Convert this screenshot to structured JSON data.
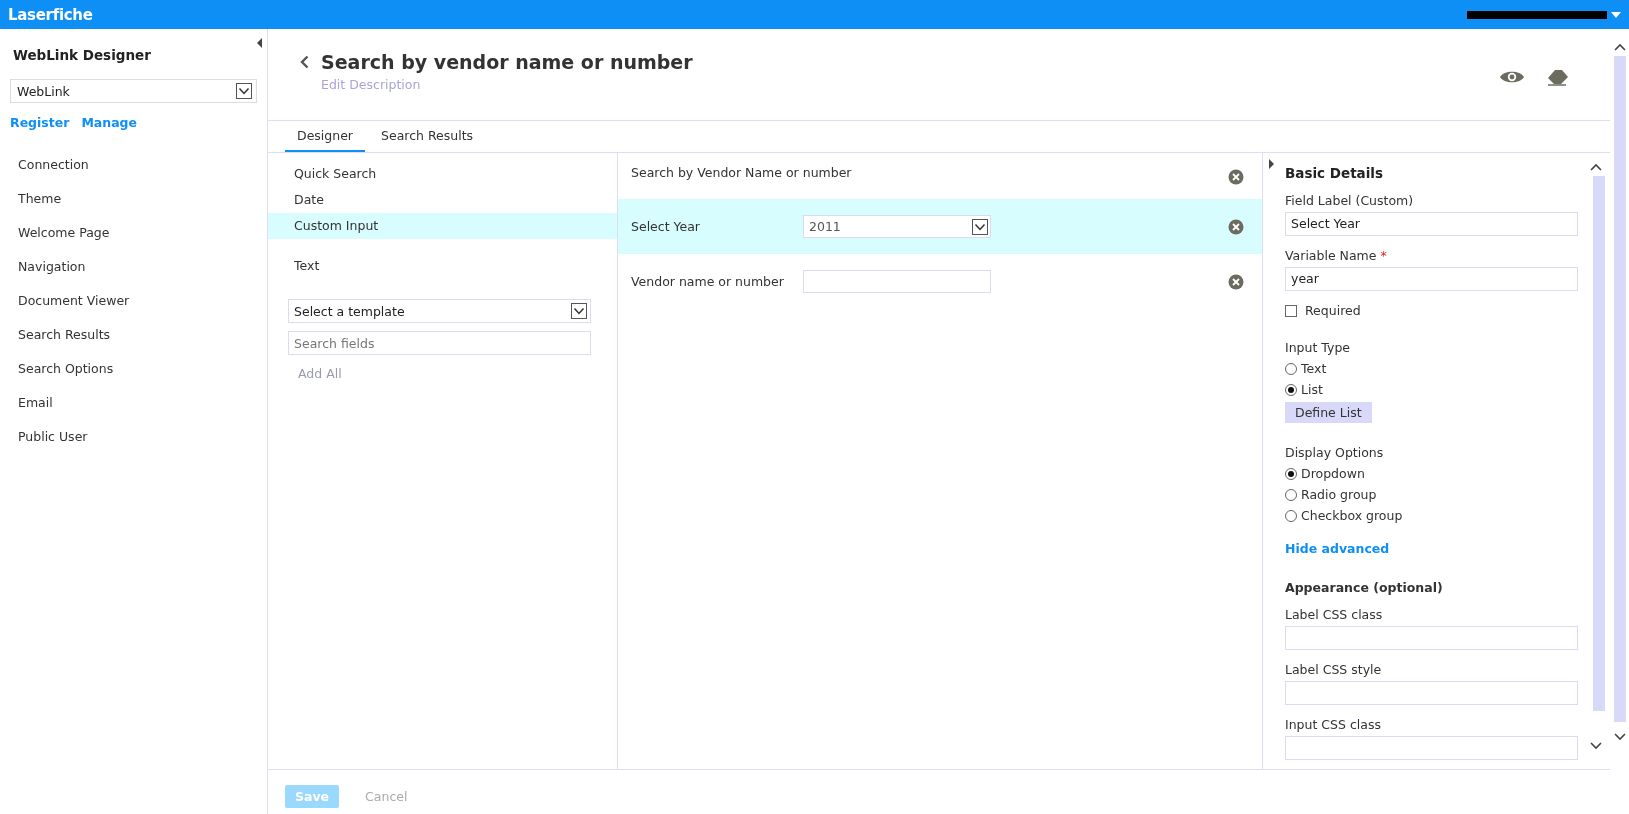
{
  "topbar": {
    "logo": "Laserfiche"
  },
  "sidebar": {
    "title": "WebLink Designer",
    "dropdown": {
      "value": "WebLink"
    },
    "links": [
      "Register",
      "Manage"
    ],
    "items": [
      {
        "label": "Connection"
      },
      {
        "label": "Theme"
      },
      {
        "label": "Welcome Page"
      },
      {
        "label": "Navigation"
      },
      {
        "label": "Document Viewer"
      },
      {
        "label": "Search Results"
      },
      {
        "label": "Search Options"
      },
      {
        "label": "Email"
      },
      {
        "label": "Public User"
      }
    ]
  },
  "header": {
    "title": "Search by vendor name or number",
    "description": {
      "placeholder": "Edit Description"
    }
  },
  "tabs": [
    {
      "label": "Designer",
      "selected": true
    },
    {
      "label": "Search Results",
      "selected": false
    }
  ],
  "field_types": [
    {
      "label": "Quick Search",
      "selected": false
    },
    {
      "label": "Date",
      "selected": false
    },
    {
      "label": "Custom Input",
      "selected": true
    },
    {
      "label": "Text",
      "selected": false
    }
  ],
  "template_select": {
    "value": "Select a template"
  },
  "search_fields": {
    "placeholder": "Search fields"
  },
  "add_all": "Add All",
  "form_fields": [
    {
      "kind": "heading",
      "label": "Search by Vendor Name or number",
      "selected": false
    },
    {
      "kind": "dropdown",
      "label": "Select Year",
      "value": "2011",
      "selected": true
    },
    {
      "kind": "text",
      "label": "Vendor name or number",
      "selected": false
    }
  ],
  "details": {
    "title": "Basic Details",
    "field_label": {
      "label": "Field Label (Custom)",
      "value": "Select Year"
    },
    "variable_name": {
      "label": "Variable Name",
      "required_mark": "*",
      "value": "year"
    },
    "required": {
      "label": "Required",
      "checked": false
    },
    "input_type": {
      "label": "Input Type",
      "options": [
        {
          "label": "Text",
          "selected": false
        },
        {
          "label": "List",
          "selected": true
        }
      ]
    },
    "define_list": "Define List",
    "display_options": {
      "label": "Display Options",
      "options": [
        {
          "label": "Dropdown",
          "selected": true
        },
        {
          "label": "Radio group",
          "selected": false
        },
        {
          "label": "Checkbox group",
          "selected": false
        }
      ]
    },
    "hide_advanced": "Hide advanced",
    "appearance": {
      "title": "Appearance (optional)",
      "fields": [
        {
          "label": "Label CSS class"
        },
        {
          "label": "Label CSS style"
        },
        {
          "label": "Input CSS class"
        }
      ]
    }
  },
  "footer": {
    "save": "Save",
    "cancel": "Cancel"
  }
}
